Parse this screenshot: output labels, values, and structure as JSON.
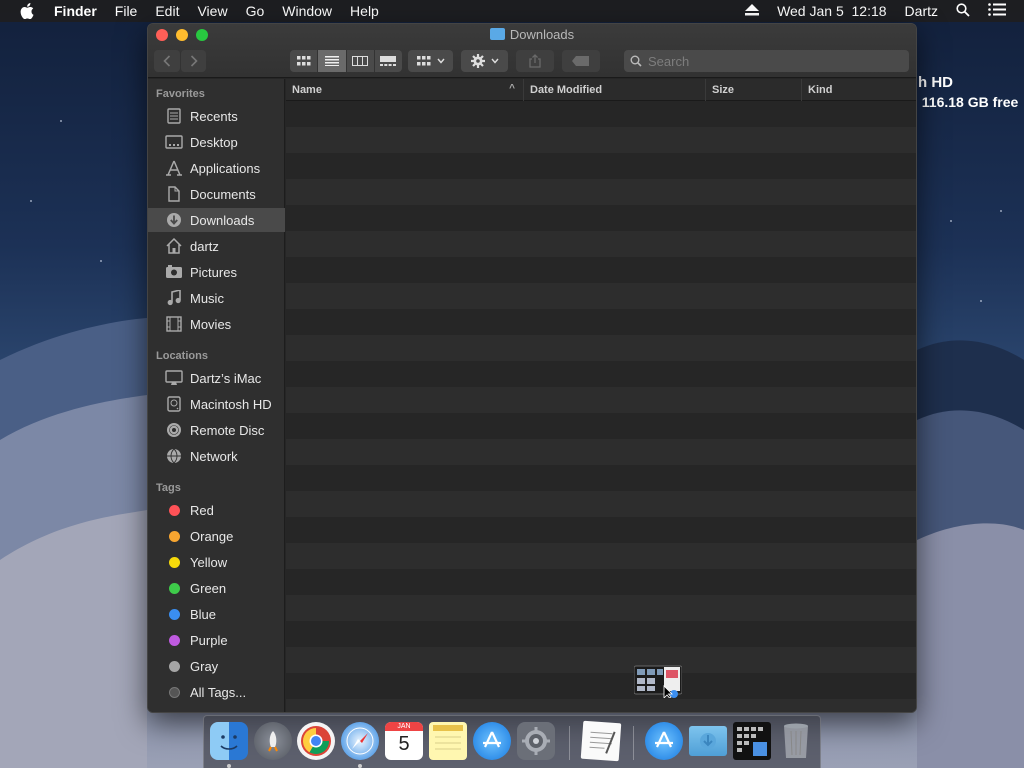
{
  "menubar": {
    "app_name": "Finder",
    "menus": [
      "File",
      "Edit",
      "View",
      "Go",
      "Window",
      "Help"
    ],
    "clock": "Wed Jan 5  12:18",
    "user": "Dartz"
  },
  "desktop": {
    "volume_label": "h HD",
    "volume_free": ", 116.18 GB free"
  },
  "window": {
    "title": "Downloads",
    "search_placeholder": "Search"
  },
  "sidebar": {
    "favorites_heading": "Favorites",
    "favorites": [
      {
        "label": "Recents",
        "icon": "recents-icon"
      },
      {
        "label": "Desktop",
        "icon": "desktop-icon"
      },
      {
        "label": "Applications",
        "icon": "applications-icon"
      },
      {
        "label": "Documents",
        "icon": "documents-icon"
      },
      {
        "label": "Downloads",
        "icon": "downloads-icon",
        "selected": true
      },
      {
        "label": "dartz",
        "icon": "home-icon"
      },
      {
        "label": "Pictures",
        "icon": "pictures-icon"
      },
      {
        "label": "Music",
        "icon": "music-icon"
      },
      {
        "label": "Movies",
        "icon": "movies-icon"
      }
    ],
    "locations_heading": "Locations",
    "locations": [
      {
        "label": "Dartz’s iMac",
        "icon": "imac-icon"
      },
      {
        "label": "Macintosh HD",
        "icon": "hard-drive-icon"
      },
      {
        "label": "Remote Disc",
        "icon": "disc-icon"
      },
      {
        "label": "Network",
        "icon": "network-icon"
      }
    ],
    "tags_heading": "Tags",
    "tags": [
      {
        "label": "Red",
        "color": "#ff5257"
      },
      {
        "label": "Orange",
        "color": "#f7a530"
      },
      {
        "label": "Yellow",
        "color": "#f5d90a"
      },
      {
        "label": "Green",
        "color": "#3ecb4a"
      },
      {
        "label": "Blue",
        "color": "#3a8ef0"
      },
      {
        "label": "Purple",
        "color": "#bf5ae0"
      },
      {
        "label": "Gray",
        "color": "#a5a5a5"
      },
      {
        "label": "All Tags...",
        "color": "#555555"
      }
    ]
  },
  "columns": {
    "name": "Name",
    "date": "Date Modified",
    "size": "Size",
    "kind": "Kind"
  },
  "dock": [
    "finder-icon",
    "launchpad-icon",
    "chrome-icon",
    "safari-icon",
    "calendar-icon",
    "notes-icon",
    "app-store-icon",
    "system-preferences-icon",
    "textedit-icon",
    "applications-folder-icon",
    "downloads-folder-icon",
    "stack-icon",
    "trash-icon"
  ],
  "calendar_icon": {
    "month": "JAN",
    "day": "5"
  }
}
